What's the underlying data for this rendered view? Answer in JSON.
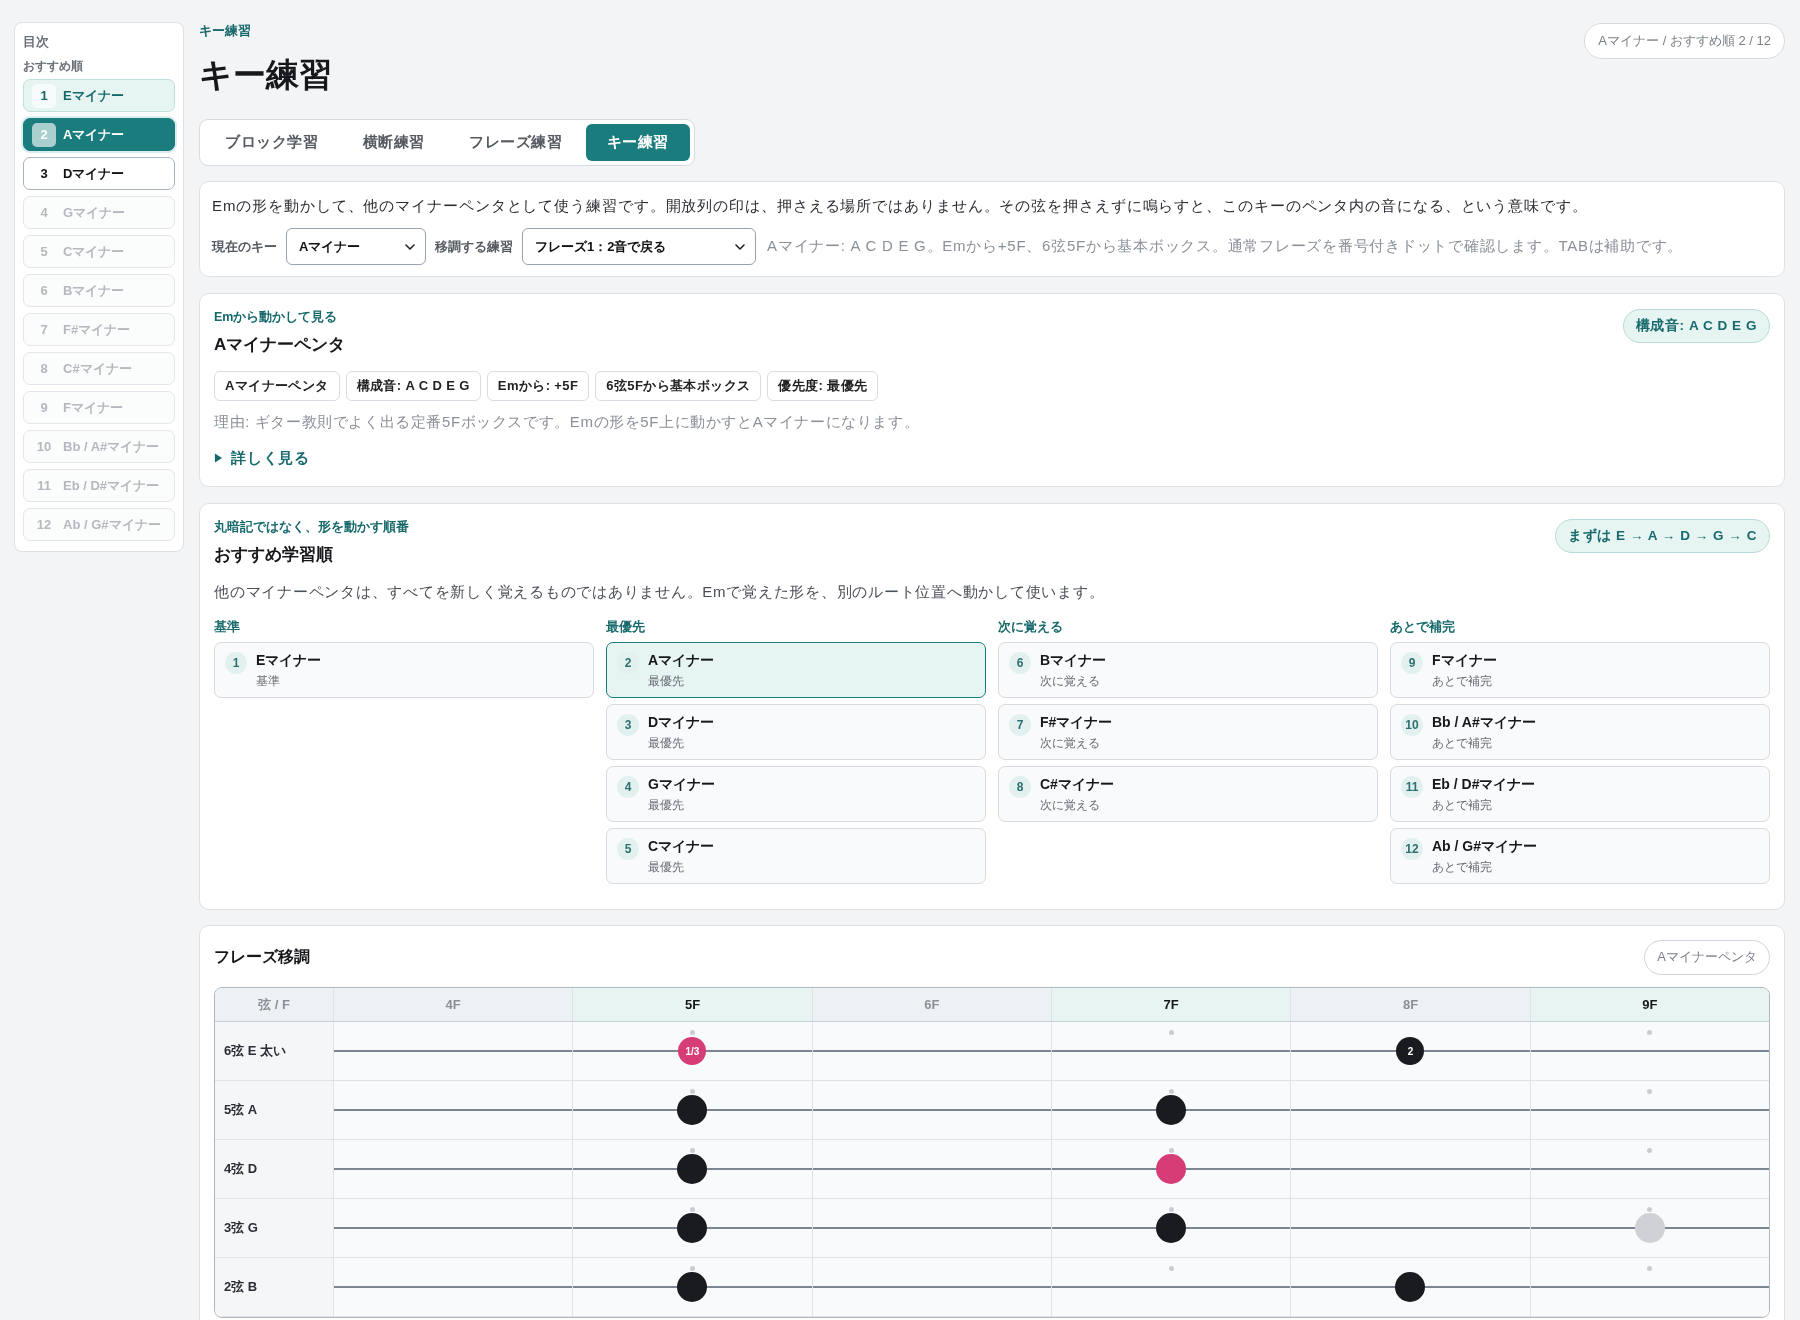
{
  "sidebar": {
    "title": "目次",
    "subtitle": "おすすめ順",
    "items": [
      {
        "number": "1",
        "label": "Eマイナー",
        "selected": false,
        "done": true,
        "disabled": false
      },
      {
        "number": "2",
        "label": "Aマイナー",
        "selected": true,
        "done": false,
        "disabled": false
      },
      {
        "number": "3",
        "label": "Dマイナー",
        "selected": false,
        "done": false,
        "disabled": false
      },
      {
        "number": "4",
        "label": "Gマイナー",
        "selected": false,
        "done": false,
        "disabled": true
      },
      {
        "number": "5",
        "label": "Cマイナー",
        "selected": false,
        "done": false,
        "disabled": true
      },
      {
        "number": "6",
        "label": "Bマイナー",
        "selected": false,
        "done": false,
        "disabled": true
      },
      {
        "number": "7",
        "label": "F#マイナー",
        "selected": false,
        "done": false,
        "disabled": true
      },
      {
        "number": "8",
        "label": "C#マイナー",
        "selected": false,
        "done": false,
        "disabled": true
      },
      {
        "number": "9",
        "label": "Fマイナー",
        "selected": false,
        "done": false,
        "disabled": true
      },
      {
        "number": "10",
        "label": "Bb / A#マイナー",
        "selected": false,
        "done": false,
        "disabled": true
      },
      {
        "number": "11",
        "label": "Eb / D#マイナー",
        "selected": false,
        "done": false,
        "disabled": true
      },
      {
        "number": "12",
        "label": "Ab / G#マイナー",
        "selected": false,
        "done": false,
        "disabled": true
      }
    ]
  },
  "header": {
    "breadcrumb": "キー練習",
    "title": "キー練習",
    "position": "Aマイナー / おすすめ順 2 / 12"
  },
  "tabs": [
    {
      "label": "ブロック学習",
      "selected": false
    },
    {
      "label": "横断練習",
      "selected": false
    },
    {
      "label": "フレーズ練習",
      "selected": false
    },
    {
      "label": "キー練習",
      "selected": true
    }
  ],
  "intro": {
    "text": "Emの形を動かして、他のマイナーペンタとして使う練習です。開放列の印は、押さえる場所ではありません。その弦を押さえずに鳴らすと、このキーのペンタ内の音になる、という意味です。",
    "controls": [
      {
        "label": "現在のキー",
        "value": "Aマイナー"
      },
      {
        "label": "移調する練習",
        "value": "フレーズ1：2音で戻る"
      }
    ],
    "hint": "Aマイナー: A C D E G。Emから+5F、6弦5Fから基本ボックス。通常フレーズを番号付きドットで確認します。TABは補助です。"
  },
  "key_card": {
    "eyebrow": "Emから動かして見る",
    "title": "Aマイナーペンタ",
    "notes_tag": "構成音: A C D E G",
    "tags": [
      "Aマイナーペンタ",
      "構成音: A C D E G",
      "Emから: +5F",
      "6弦5Fから基本ボックス",
      "優先度: 最優先"
    ],
    "reason": "理由: ギター教則でよく出る定番5Fボックスです。Emの形を5F上に動かすとAマイナーになります。",
    "details": {
      "label": "詳しく見る",
      "expanded": false
    }
  },
  "learning_order": {
    "eyebrow": "丸暗記ではなく、形を動かす順番",
    "title": "おすすめ学習順",
    "route_tag": "まずは E → A → D → G → C",
    "description": "他のマイナーペンタは、すべてを新しく覚えるものではありません。Emで覚えた形を、別のルート位置へ動かして使います。",
    "groups": [
      {
        "heading": "基準",
        "items": [
          {
            "number": "1",
            "name": "Eマイナー",
            "sub": "基準",
            "selected": false
          }
        ]
      },
      {
        "heading": "最優先",
        "items": [
          {
            "number": "2",
            "name": "Aマイナー",
            "sub": "最優先",
            "selected": true
          },
          {
            "number": "3",
            "name": "Dマイナー",
            "sub": "最優先",
            "selected": false
          },
          {
            "number": "4",
            "name": "Gマイナー",
            "sub": "最優先",
            "selected": false
          },
          {
            "number": "5",
            "name": "Cマイナー",
            "sub": "最優先",
            "selected": false
          }
        ]
      },
      {
        "heading": "次に覚える",
        "items": [
          {
            "number": "6",
            "name": "Bマイナー",
            "sub": "次に覚える",
            "selected": false
          },
          {
            "number": "7",
            "name": "F#マイナー",
            "sub": "次に覚える",
            "selected": false
          },
          {
            "number": "8",
            "name": "C#マイナー",
            "sub": "次に覚える",
            "selected": false
          }
        ]
      },
      {
        "heading": "あとで補完",
        "items": [
          {
            "number": "9",
            "name": "Fマイナー",
            "sub": "あとで補完",
            "selected": false
          },
          {
            "number": "10",
            "name": "Bb / A#マイナー",
            "sub": "あとで補完",
            "selected": false
          },
          {
            "number": "11",
            "name": "Eb / D#マイナー",
            "sub": "あとで補完",
            "selected": false
          },
          {
            "number": "12",
            "name": "Ab / G#マイナー",
            "sub": "あとで補完",
            "selected": false
          }
        ]
      }
    ]
  },
  "fretboard": {
    "title": "フレーズ移調",
    "scale_tag": "Aマイナーペンタ",
    "corner_header": "弦 / F",
    "frets": [
      {
        "label": "4F",
        "highlighted": false
      },
      {
        "label": "5F",
        "highlighted": true
      },
      {
        "label": "6F",
        "highlighted": false
      },
      {
        "label": "7F",
        "highlighted": true
      },
      {
        "label": "8F",
        "highlighted": false
      },
      {
        "label": "9F",
        "highlighted": true
      }
    ],
    "strings": [
      {
        "label": "6弦 E 太い",
        "cells": [
          {
            "kind": "empty"
          },
          {
            "kind": "root",
            "text": "1/3"
          },
          {
            "kind": "empty"
          },
          {
            "kind": "empty"
          },
          {
            "kind": "note",
            "text": "2"
          },
          {
            "kind": "empty"
          }
        ]
      },
      {
        "label": "5弦 A",
        "cells": [
          {
            "kind": "empty"
          },
          {
            "kind": "note"
          },
          {
            "kind": "empty"
          },
          {
            "kind": "note"
          },
          {
            "kind": "empty"
          },
          {
            "kind": "empty"
          }
        ]
      },
      {
        "label": "4弦 D",
        "cells": [
          {
            "kind": "empty"
          },
          {
            "kind": "note"
          },
          {
            "kind": "empty"
          },
          {
            "kind": "root"
          },
          {
            "kind": "empty"
          },
          {
            "kind": "empty"
          }
        ]
      },
      {
        "label": "3弦 G",
        "cells": [
          {
            "kind": "empty"
          },
          {
            "kind": "note"
          },
          {
            "kind": "empty"
          },
          {
            "kind": "note"
          },
          {
            "kind": "empty"
          },
          {
            "kind": "ghost"
          }
        ]
      },
      {
        "label": "2弦 B",
        "cells": [
          {
            "kind": "empty"
          },
          {
            "kind": "note"
          },
          {
            "kind": "empty"
          },
          {
            "kind": "empty"
          },
          {
            "kind": "note"
          },
          {
            "kind": "empty"
          }
        ]
      }
    ]
  }
}
